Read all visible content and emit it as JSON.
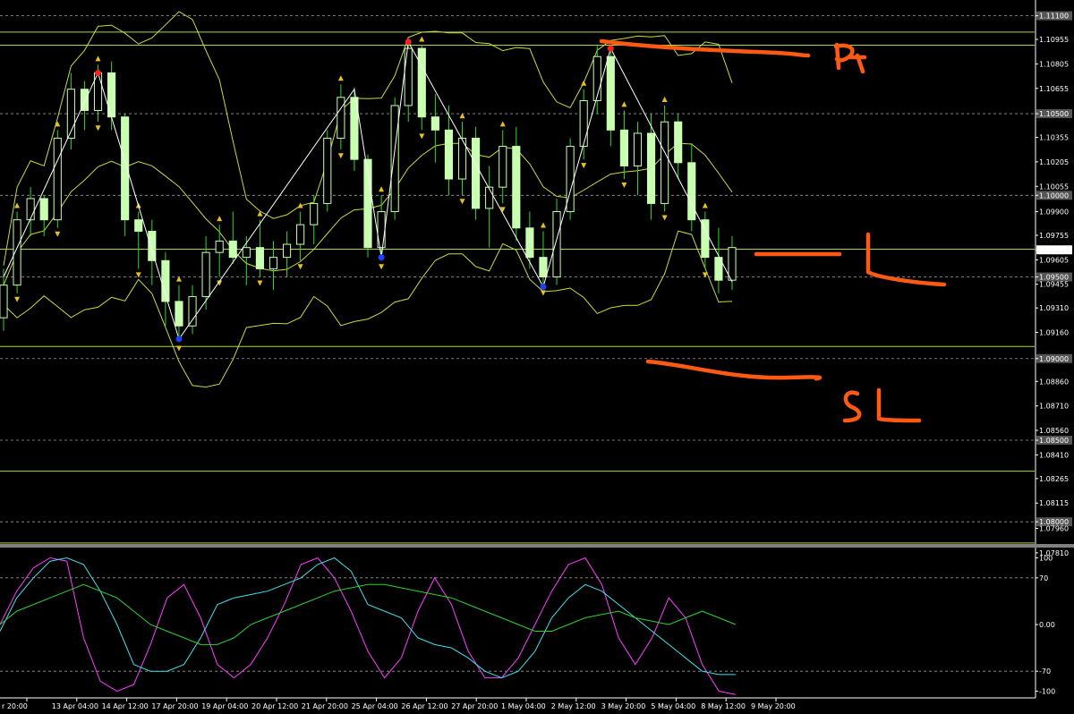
{
  "chart_data": [
    {
      "type": "candlestick",
      "instrument_panel": "main",
      "y_ticks": [
        "1.11100",
        "1.10955",
        "1.10805",
        "1.10655",
        "1.10500",
        "1.10355",
        "1.10205",
        "1.10055",
        "1.10000",
        "1.09900",
        "1.09755",
        "1.09666",
        "1.09605",
        "1.09500",
        "1.09455",
        "1.09310",
        "1.09160",
        "1.09000",
        "1.08860",
        "1.08710",
        "1.08560",
        "1.08500",
        "1.08410",
        "1.08265",
        "1.08115",
        "1.08000",
        "1.07960",
        "1.07810"
      ],
      "highlighted_ticks": [
        "1.11100",
        "1.10500",
        "1.10000",
        "1.09500",
        "1.09000",
        "1.08500",
        "1.08000"
      ],
      "current_price": "1.09666",
      "ylim": [
        1.0776,
        1.1118
      ],
      "dashed_levels": [
        1.111,
        1.105,
        1.1,
        1.095,
        1.09,
        1.085,
        1.08
      ],
      "horizontal_levels": [
        1.11,
        1.1092,
        1.0967,
        1.09074,
        1.0831,
        1.0787
      ],
      "x_ticks": [
        "r 20:00",
        "13 Apr 04:00",
        "14 Apr 12:00",
        "17 Apr 20:00",
        "19 Apr 04:00",
        "20 Apr 12:00",
        "21 Apr 20:00",
        "25 Apr 04:00",
        "26 Apr 12:00",
        "27 Apr 20:00",
        "1 May 04:00",
        "2 May 12:00",
        "3 May 20:00",
        "5 May 04:00",
        "8 May 12:00",
        "9 May 20:00"
      ],
      "candles": [
        [
          1.0925,
          1.0955,
          1.0917,
          1.0945
        ],
        [
          1.0945,
          1.099,
          1.094,
          1.0985
        ],
        [
          1.0985,
          1.1005,
          1.0975,
          1.0998
        ],
        [
          1.0998,
          1.1,
          1.0975,
          1.0985
        ],
        [
          1.0985,
          1.104,
          1.098,
          1.1035
        ],
        [
          1.1035,
          1.1075,
          1.1028,
          1.1065
        ],
        [
          1.1065,
          1.107,
          1.104,
          1.1052
        ],
        [
          1.1052,
          1.108,
          1.1045,
          1.1075
        ],
        [
          1.1075,
          1.1082,
          1.104,
          1.1048
        ],
        [
          1.1048,
          1.105,
          1.0975,
          1.0985
        ],
        [
          1.0985,
          1.099,
          1.0955,
          1.0978
        ],
        [
          1.0978,
          1.0985,
          1.0945,
          1.096
        ],
        [
          1.096,
          1.0965,
          1.092,
          1.0935
        ],
        [
          1.0935,
          1.0945,
          1.091,
          1.092
        ],
        [
          1.092,
          1.0945,
          1.0915,
          1.0938
        ],
        [
          1.0938,
          1.0975,
          1.093,
          1.0965
        ],
        [
          1.0965,
          1.0982,
          1.095,
          1.0972
        ],
        [
          1.0972,
          1.099,
          1.0958,
          1.0962
        ],
        [
          1.0962,
          1.0975,
          1.0945,
          1.0968
        ],
        [
          1.0968,
          1.0985,
          1.095,
          1.0955
        ],
        [
          1.0955,
          1.0972,
          1.0942,
          1.0962
        ],
        [
          1.0962,
          1.0978,
          1.095,
          1.097
        ],
        [
          1.097,
          1.099,
          1.096,
          1.0982
        ],
        [
          1.0982,
          1.1,
          1.097,
          1.0995
        ],
        [
          1.0995,
          1.104,
          1.099,
          1.1035
        ],
        [
          1.1035,
          1.1068,
          1.1028,
          1.106
        ],
        [
          1.106,
          1.1066,
          1.1015,
          1.1022
        ],
        [
          1.1022,
          1.1025,
          1.0962,
          1.0968
        ],
        [
          1.0968,
          1.1,
          1.096,
          1.099
        ],
        [
          1.099,
          1.106,
          1.0985,
          1.1055
        ],
        [
          1.1055,
          1.1095,
          1.1045,
          1.109
        ],
        [
          1.109,
          1.1092,
          1.104,
          1.1048
        ],
        [
          1.1048,
          1.1062,
          1.102,
          1.104
        ],
        [
          1.104,
          1.1055,
          1.1,
          1.101
        ],
        [
          1.101,
          1.1045,
          1.1,
          1.1035
        ],
        [
          1.1035,
          1.1042,
          1.0985,
          1.0992
        ],
        [
          1.0992,
          1.1018,
          1.0968,
          1.1005
        ],
        [
          1.1005,
          1.104,
          1.0995,
          1.103
        ],
        [
          1.103,
          1.1042,
          1.0972,
          1.098
        ],
        [
          1.098,
          1.099,
          1.0955,
          1.0962
        ],
        [
          1.0962,
          1.0978,
          1.0944,
          1.095
        ],
        [
          1.095,
          1.0998,
          1.0945,
          1.099
        ],
        [
          1.099,
          1.1035,
          1.0985,
          1.103
        ],
        [
          1.103,
          1.1065,
          1.1022,
          1.1058
        ],
        [
          1.1058,
          1.1092,
          1.105,
          1.1085
        ],
        [
          1.1085,
          1.109,
          1.103,
          1.104
        ],
        [
          1.104,
          1.1052,
          1.101,
          1.1018
        ],
        [
          1.1018,
          1.1045,
          1.1,
          1.1038
        ],
        [
          1.1038,
          1.105,
          1.0985,
          1.0995
        ],
        [
          1.0995,
          1.1055,
          1.099,
          1.1045
        ],
        [
          1.1045,
          1.105,
          1.101,
          1.102
        ],
        [
          1.102,
          1.1032,
          1.0978,
          1.0985
        ],
        [
          1.0985,
          1.099,
          1.0955,
          1.0962
        ],
        [
          1.0962,
          1.098,
          1.094,
          1.0948
        ],
        [
          1.0948,
          1.0975,
          1.0942,
          1.0968
        ]
      ],
      "zigzag": [
        [
          0,
          1.095
        ],
        [
          7,
          1.1075
        ],
        [
          13,
          1.0912
        ],
        [
          26,
          1.1065
        ],
        [
          28,
          1.0962
        ],
        [
          30,
          1.1094
        ],
        [
          40,
          1.0944
        ],
        [
          45,
          1.109
        ],
        [
          54,
          1.0947
        ]
      ],
      "markers": [
        {
          "color": "#ff2020",
          "point": [
            7,
            1.1075
          ]
        },
        {
          "color": "#ff2020",
          "point": [
            30,
            1.1094
          ]
        },
        {
          "color": "#ff2020",
          "point": [
            45,
            1.109
          ]
        },
        {
          "color": "#2040ff",
          "point": [
            13,
            1.0912
          ]
        },
        {
          "color": "#2040ff",
          "point": [
            28,
            1.0962
          ]
        },
        {
          "color": "#2040ff",
          "point": [
            40,
            1.0944
          ]
        }
      ],
      "colors": {
        "candle": "#c8ffb0",
        "wick": "#2dd82d",
        "zigzag": "#ffffff",
        "band": "#c8dc37",
        "level": "#a8d84a",
        "grid": "#9a9a9a",
        "arrow": "#e6c21e"
      },
      "annotations": [
        "PT",
        "L",
        "SL"
      ]
    },
    {
      "type": "line",
      "instrument_panel": "oscillator",
      "y_ticks": [
        "100",
        "70",
        "0.00",
        "-70",
        "-100"
      ],
      "ylim": [
        -110,
        110
      ],
      "dashed_levels": [
        70,
        -70
      ],
      "series": [
        {
          "color": "#ff3cff",
          "values": [
            0,
            50,
            85,
            100,
            95,
            -20,
            -85,
            -100,
            -90,
            -30,
            40,
            60,
            10,
            -60,
            -80,
            -60,
            -20,
            30,
            90,
            100,
            70,
            20,
            -40,
            -80,
            -50,
            20,
            70,
            30,
            -40,
            -80,
            -80,
            -50,
            0,
            50,
            90,
            100,
            60,
            -20,
            -60,
            -20,
            40,
            10,
            -60,
            -100,
            -105
          ]
        },
        {
          "color": "#40e0e8",
          "values": [
            -10,
            40,
            70,
            95,
            100,
            90,
            50,
            0,
            -60,
            -70,
            -70,
            -60,
            -20,
            30,
            40,
            45,
            50,
            60,
            70,
            90,
            100,
            80,
            30,
            20,
            10,
            -20,
            -30,
            -35,
            -50,
            -70,
            -80,
            -70,
            -40,
            10,
            40,
            60,
            50,
            30,
            10,
            -10,
            -30,
            -50,
            -70,
            -75,
            -75
          ]
        },
        {
          "color": "#30d030",
          "values": [
            0,
            20,
            30,
            40,
            50,
            60,
            50,
            40,
            20,
            0,
            -10,
            -20,
            -30,
            -30,
            -20,
            0,
            10,
            20,
            30,
            40,
            50,
            55,
            60,
            60,
            55,
            50,
            45,
            40,
            30,
            20,
            10,
            0,
            -10,
            -10,
            0,
            10,
            15,
            20,
            10,
            5,
            0,
            10,
            20,
            10,
            0
          ]
        }
      ]
    }
  ]
}
